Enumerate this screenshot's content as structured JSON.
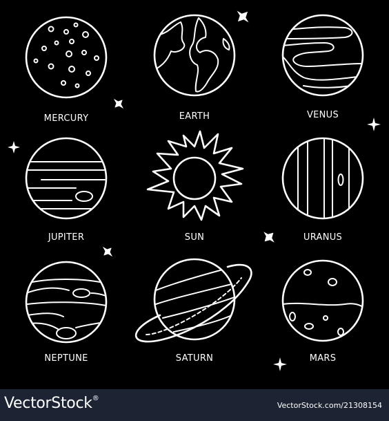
{
  "colors": {
    "background": "#000000",
    "line": "#ffffff",
    "footer": "#1c2433"
  },
  "planets": [
    {
      "key": "mercury",
      "label": "MERCURY",
      "icon": "mercury-icon"
    },
    {
      "key": "earth",
      "label": "EARTH",
      "icon": "earth-icon"
    },
    {
      "key": "venus",
      "label": "VENUS",
      "icon": "venus-icon"
    },
    {
      "key": "jupiter",
      "label": "JUPITER",
      "icon": "jupiter-icon"
    },
    {
      "key": "sun",
      "label": "SUN",
      "icon": "sun-icon"
    },
    {
      "key": "uranus",
      "label": "URANUS",
      "icon": "uranus-icon"
    },
    {
      "key": "neptune",
      "label": "NEPTUNE",
      "icon": "neptune-icon"
    },
    {
      "key": "saturn",
      "label": "SATURN",
      "icon": "saturn-icon"
    },
    {
      "key": "mars",
      "label": "MARS",
      "icon": "mars-icon"
    }
  ],
  "watermark": {
    "brand": "VectorStock",
    "registered": "®",
    "url": "VectorStock.com/21308154"
  }
}
